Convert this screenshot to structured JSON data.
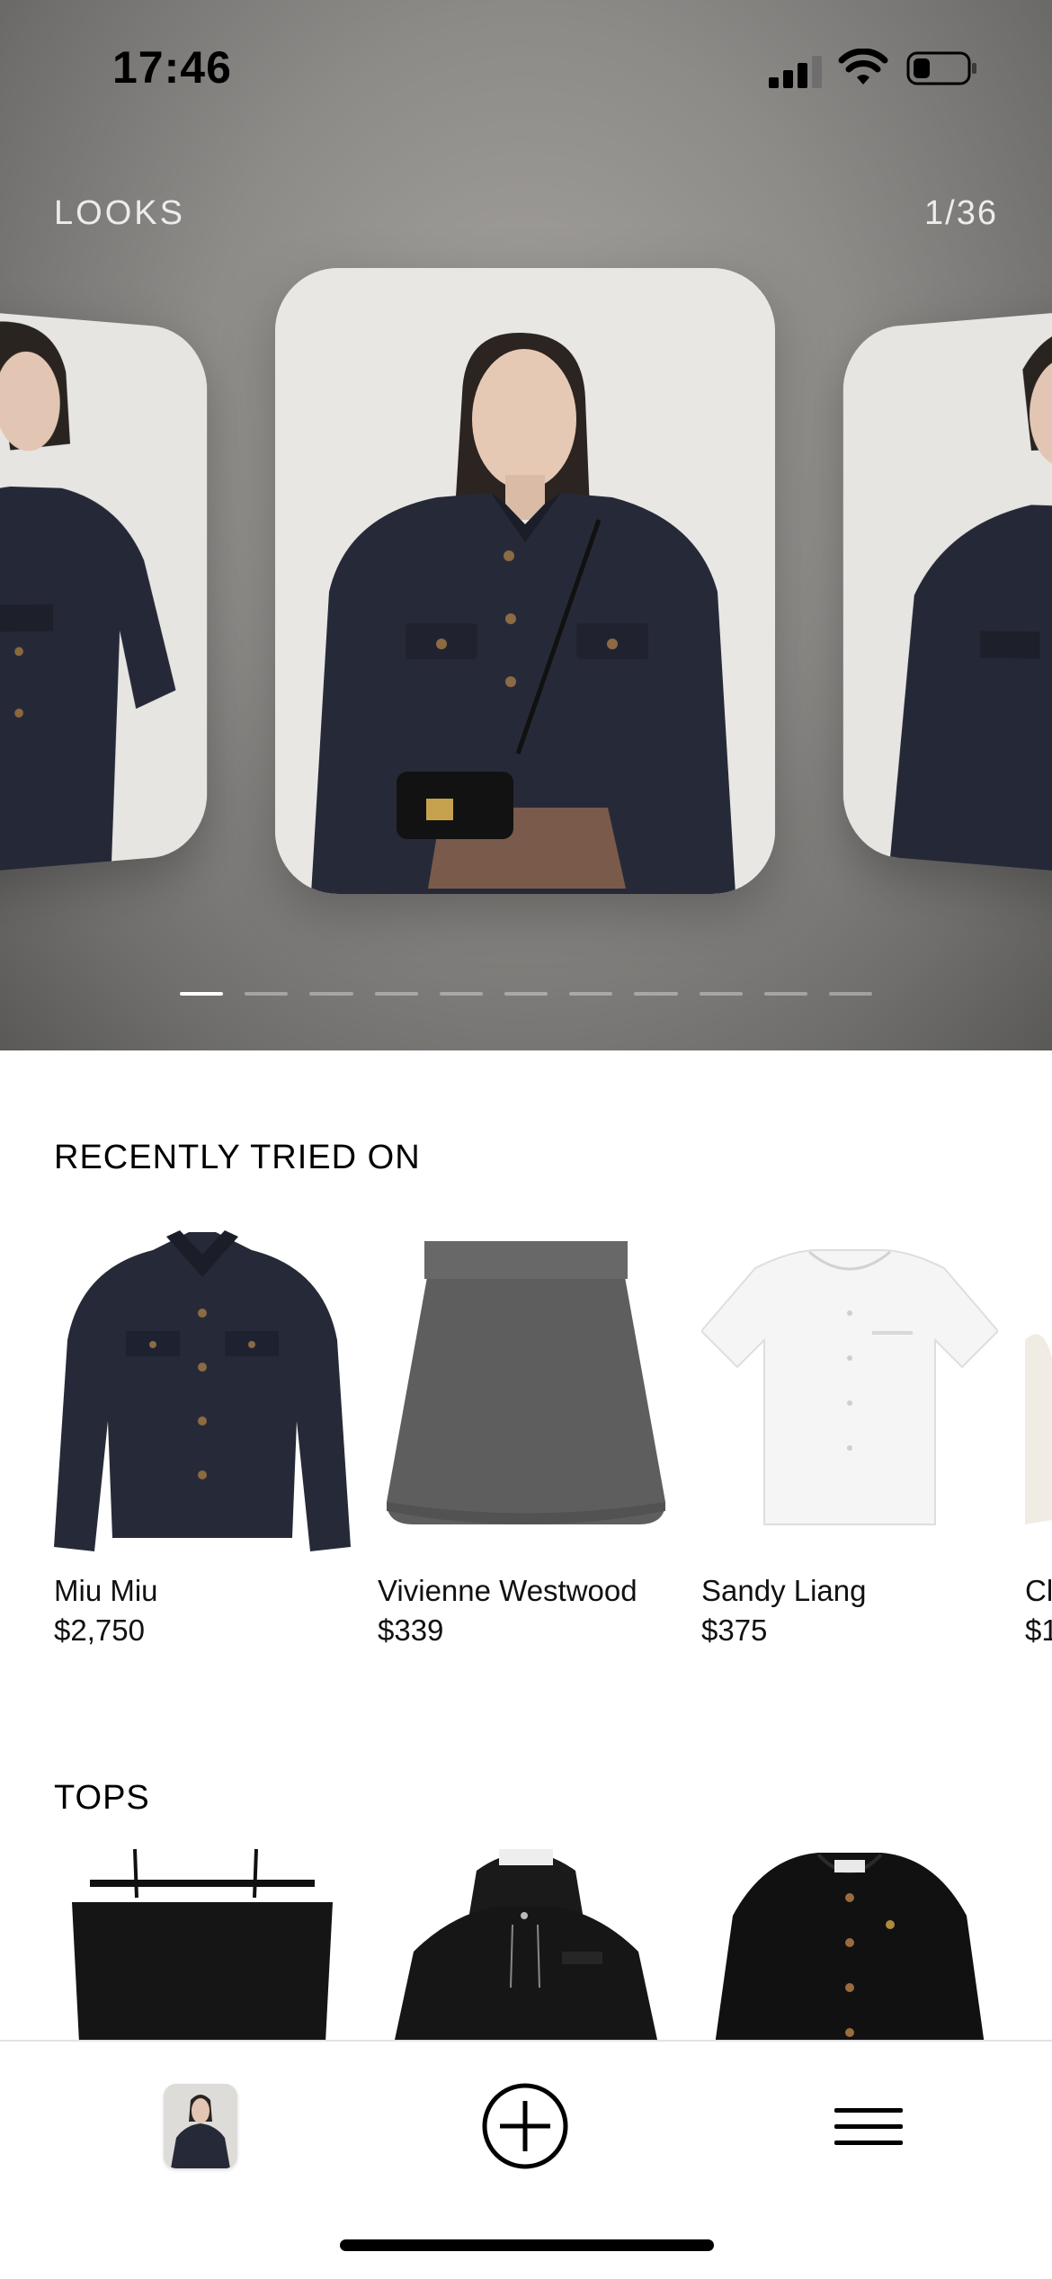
{
  "status_bar": {
    "time": "17:46",
    "signal_icon": "cellular-signal-icon",
    "wifi_icon": "wifi-icon",
    "battery_icon": "battery-low-icon"
  },
  "looks": {
    "title": "LOOKS",
    "counter": "1/36",
    "page_dots_total": 11,
    "page_dots_active_index": 0
  },
  "recently_tried_on": {
    "title": "RECENTLY TRIED ON",
    "items": [
      {
        "brand": "Miu Miu",
        "price": "$2,750",
        "image": "navy-denim-jacket"
      },
      {
        "brand": "Vivienne Westwood",
        "price": "$339",
        "image": "grey-knit-mini-skirt"
      },
      {
        "brand": "Sandy Liang",
        "price": "$375",
        "image": "white-short-sleeve-shirt"
      },
      {
        "brand": "Cl",
        "price": "$1",
        "image": "cream-knit-item"
      }
    ]
  },
  "tops": {
    "title": "TOPS",
    "items": [
      {
        "image": "black-off-shoulder-top"
      },
      {
        "image": "black-hooded-jacket"
      },
      {
        "image": "black-cardigan"
      }
    ]
  },
  "tab_bar": {
    "profile_icon": "profile-avatar-icon",
    "add_icon": "plus-circle-icon",
    "menu_icon": "hamburger-menu-icon"
  },
  "colors": {
    "hero_background": "#8d8b88",
    "jacket_navy": "#262a38",
    "skirt_grey": "#5e5e5e",
    "accent_white": "#ffffff"
  }
}
